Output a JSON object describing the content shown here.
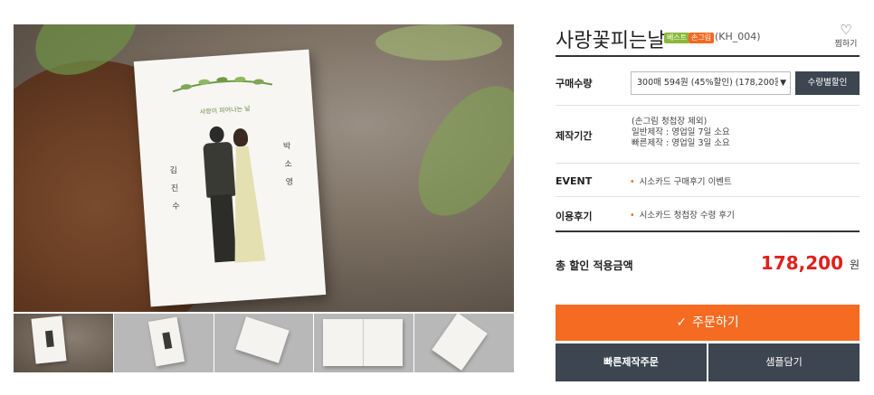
{
  "gallery": {
    "card_title": "사랑이 피어나는 날",
    "name_left": "김 진 수",
    "name_right": "박 소 영",
    "thumbnail_count": 5
  },
  "product": {
    "title": "사랑꽃피는날",
    "badge_best": "베스트",
    "badge_hand": "손그림",
    "code": "(KH_004)",
    "wish_label": "찜하기"
  },
  "options": {
    "qty_label": "구매수량",
    "qty_selected": "300매 594원 (45%할인) (178,200원)",
    "qty_discount_button": "수량별할인",
    "period_label": "제작기간",
    "period_lines": [
      "(손그림 청첩장 제외)",
      "일반제작 : 영업일 7일 소요",
      "빠른제작 : 영업일 3일 소요"
    ],
    "event_label": "EVENT",
    "event_text": "시소카드 구매후기 이벤트",
    "review_label": "이용후기",
    "review_text": "시소카드 청첩장 수령 후기"
  },
  "total": {
    "label": "총 할인 적용금액",
    "price": "178,200",
    "unit": "원"
  },
  "actions": {
    "order": "주문하기",
    "fast_order": "빠른제작주문",
    "sample": "샘플담기"
  },
  "colors": {
    "accent_orange": "#f46b21",
    "price_red": "#e0201c",
    "dark_button": "#3c4550",
    "badge_green": "#8bb83a"
  }
}
